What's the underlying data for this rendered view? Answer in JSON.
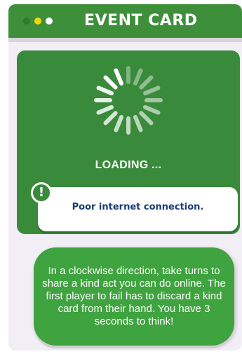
{
  "header": {
    "title": "EVENT CARD",
    "dots": [
      {
        "color": "#2f7a2b"
      },
      {
        "color": "#f5d60a"
      },
      {
        "color": "#ffffff"
      }
    ]
  },
  "loading": {
    "label": "LOADING ...",
    "spinner_icon": "spinner-icon"
  },
  "error": {
    "icon": "alert-icon",
    "icon_glyph": "!",
    "message": "Poor internet connection."
  },
  "event": {
    "text": "In a clockwise direction, take turns to share a kind act you can do online. The first player to fail has to discard a kind card from their hand. You have 3 seconds to think!"
  },
  "colors": {
    "header_green": "#3e8f3a",
    "panel_green": "#3a8a3b",
    "message_green": "#3fa33f",
    "card_bg": "#f1eef5",
    "error_text": "#1b3b73"
  }
}
